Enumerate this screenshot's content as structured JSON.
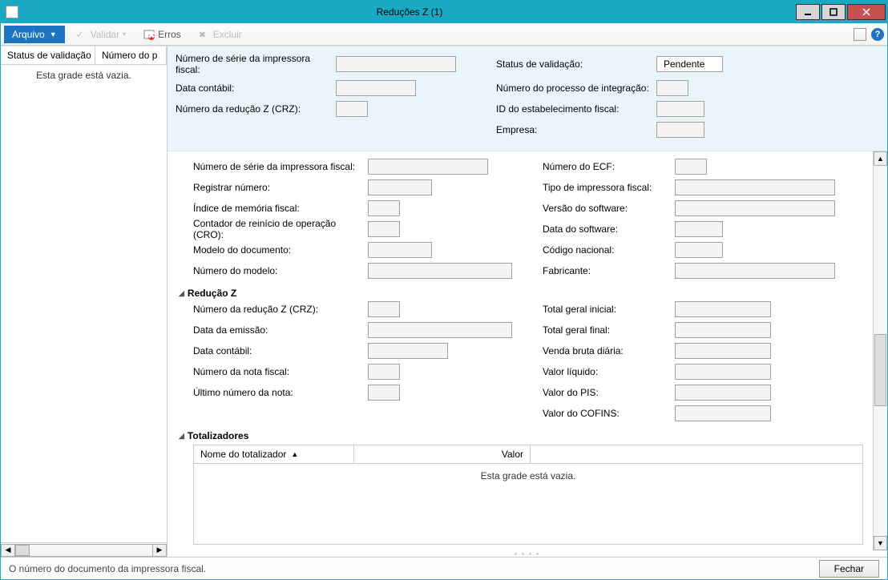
{
  "window": {
    "title": "Reduções Z (1)"
  },
  "toolbar": {
    "file": "Arquivo",
    "validate": "Validar",
    "errors": "Erros",
    "delete": "Excluir"
  },
  "left": {
    "col1": "Status de validação",
    "col2": "Número do p",
    "empty": "Esta grade está vazia."
  },
  "header": {
    "serie_label": "Número de série da impressora fiscal:",
    "serie_value": "",
    "status_label": "Status de validação:",
    "status_value": "Pendente",
    "data_contabil_label": "Data contábil:",
    "data_contabil_value": "",
    "proc_integ_label": "Número do processo de integração:",
    "proc_integ_value": "",
    "crz_label": "Número da redução Z (CRZ):",
    "crz_value": "",
    "estab_label": "ID do estabelecimento fiscal:",
    "estab_value": "",
    "empresa_label": "Empresa:",
    "empresa_value": ""
  },
  "sec_printer": {
    "serie": "Número de série da impressora fiscal:",
    "ecf": "Número do ECF:",
    "reg_num": "Registrar número:",
    "tipo_impr": "Tipo de impressora fiscal:",
    "mem_idx": "Índice de memória fiscal:",
    "sw_ver": "Versão do software:",
    "cro": "Contador de reinício de operação (CRO):",
    "sw_date": "Data do software:",
    "modelo_doc": "Modelo do documento:",
    "cod_nac": "Código nacional:",
    "num_modelo": "Número do modelo:",
    "fabricante": "Fabricante:"
  },
  "sec_redz": {
    "title": "Redução Z",
    "crz": "Número da redução Z (CRZ):",
    "total_ini": "Total geral inicial:",
    "data_emis": "Data da emissão:",
    "total_fin": "Total geral final:",
    "data_cont": "Data contábil:",
    "venda_bruta": "Venda bruta diária:",
    "num_nf": "Número da nota fiscal:",
    "valor_liq": "Valor líquido:",
    "ult_nota": "Último número da nota:",
    "valor_pis": "Valor do PIS:",
    "valor_cofins": "Valor do COFINS:"
  },
  "sec_tot": {
    "title": "Totalizadores",
    "col_nome": "Nome do totalizador",
    "col_valor": "Valor",
    "empty": "Esta grade está vazia."
  },
  "statusbar": {
    "msg": "O número do documento da impressora fiscal.",
    "close": "Fechar"
  }
}
